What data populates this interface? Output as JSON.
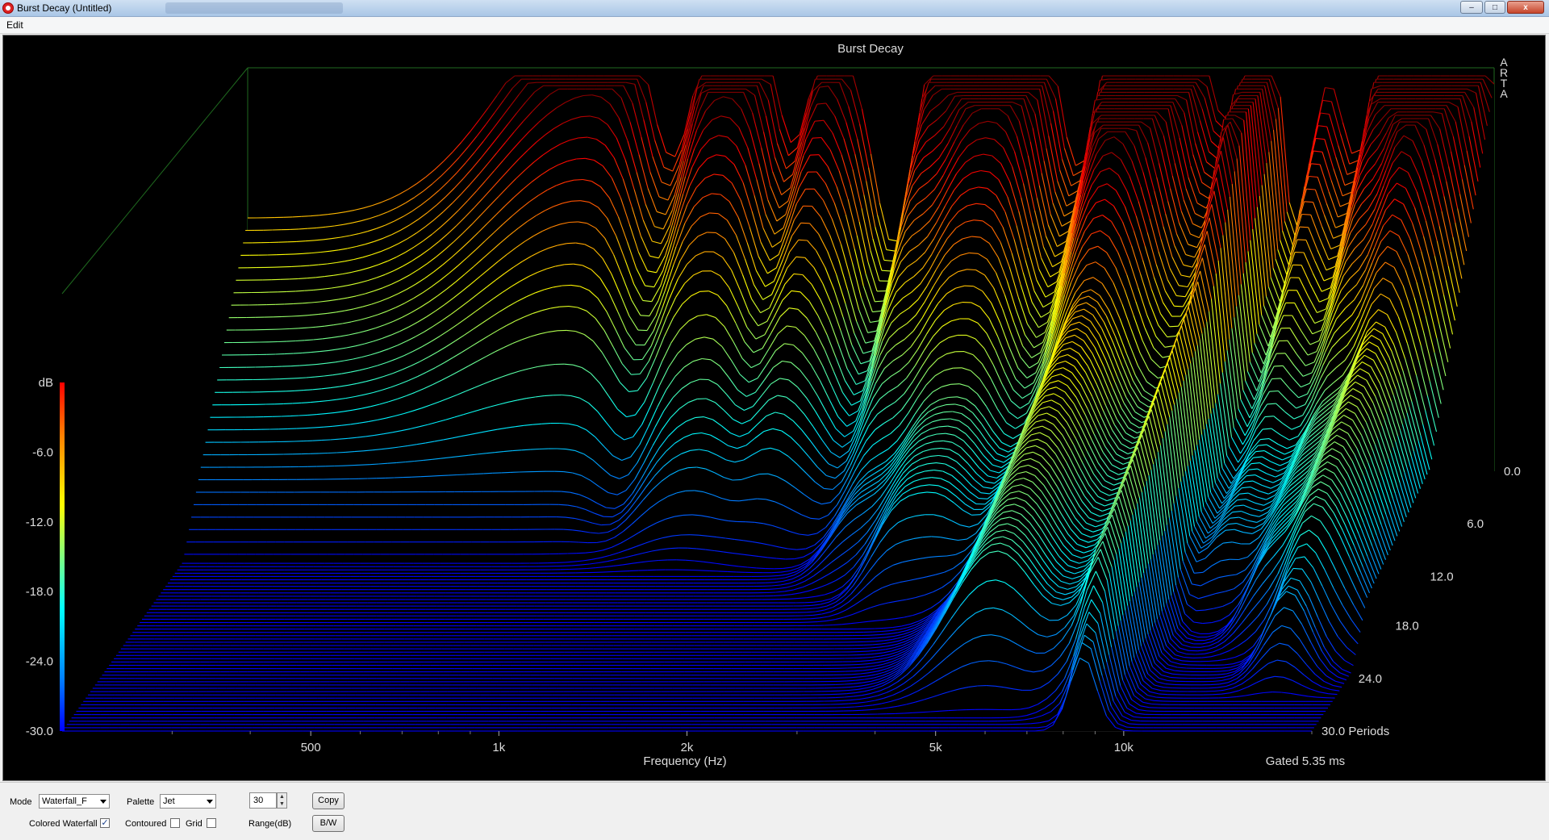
{
  "window": {
    "title": "Burst Decay  (Untitled)",
    "minimize_label": "–",
    "maximize_label": "□",
    "close_label": "x"
  },
  "menu": {
    "items": [
      "Edit"
    ]
  },
  "plot": {
    "title": "Burst Decay",
    "brand": [
      "A",
      "R",
      "T",
      "A"
    ],
    "x_axis_label": "Frequency (Hz)",
    "x_ticks": [
      "500",
      "1k",
      "2k",
      "5k",
      "10k"
    ],
    "x_tick_values": [
      500,
      1000,
      2000,
      5000,
      10000
    ],
    "colorbar_label": "dB",
    "colorbar_ticks": [
      "-6.0",
      "-12.0",
      "-18.0",
      "-24.0",
      "-30.0"
    ],
    "depth_ticks": [
      "0.0",
      "6.0",
      "12.0",
      "18.0",
      "24.0",
      "30.0 Periods"
    ],
    "gated_text": "Gated 5.35 ms",
    "palette_colors": [
      "#00007f",
      "#0000ff",
      "#007fff",
      "#00ffff",
      "#7fff7f",
      "#ffff00",
      "#ff7f00",
      "#ff0000",
      "#7f0000"
    ]
  },
  "chart_data": {
    "type": "waterfall",
    "title": "Burst Decay",
    "xlabel": "Frequency (Hz)",
    "x_scale": "log",
    "xlim": [
      200,
      20000
    ],
    "zlabel": "dB",
    "zlim": [
      -30,
      0
    ],
    "depth_label": "Periods",
    "depth_range": [
      0,
      30
    ],
    "slices_shown": 80,
    "gated_ms": 5.35
  },
  "controls": {
    "mode_label": "Mode",
    "mode_value": "Waterfall_F",
    "palette_label": "Palette",
    "palette_value": "Jet",
    "range_value": "30",
    "range_label": "Range(dB)",
    "copy_label": "Copy",
    "bw_label": "B/W",
    "colored_waterfall_label": "Colored Waterfall",
    "colored_waterfall_checked": true,
    "contoured_label": "Contoured",
    "contoured_checked": false,
    "grid_label": "Grid",
    "grid_checked": false
  }
}
